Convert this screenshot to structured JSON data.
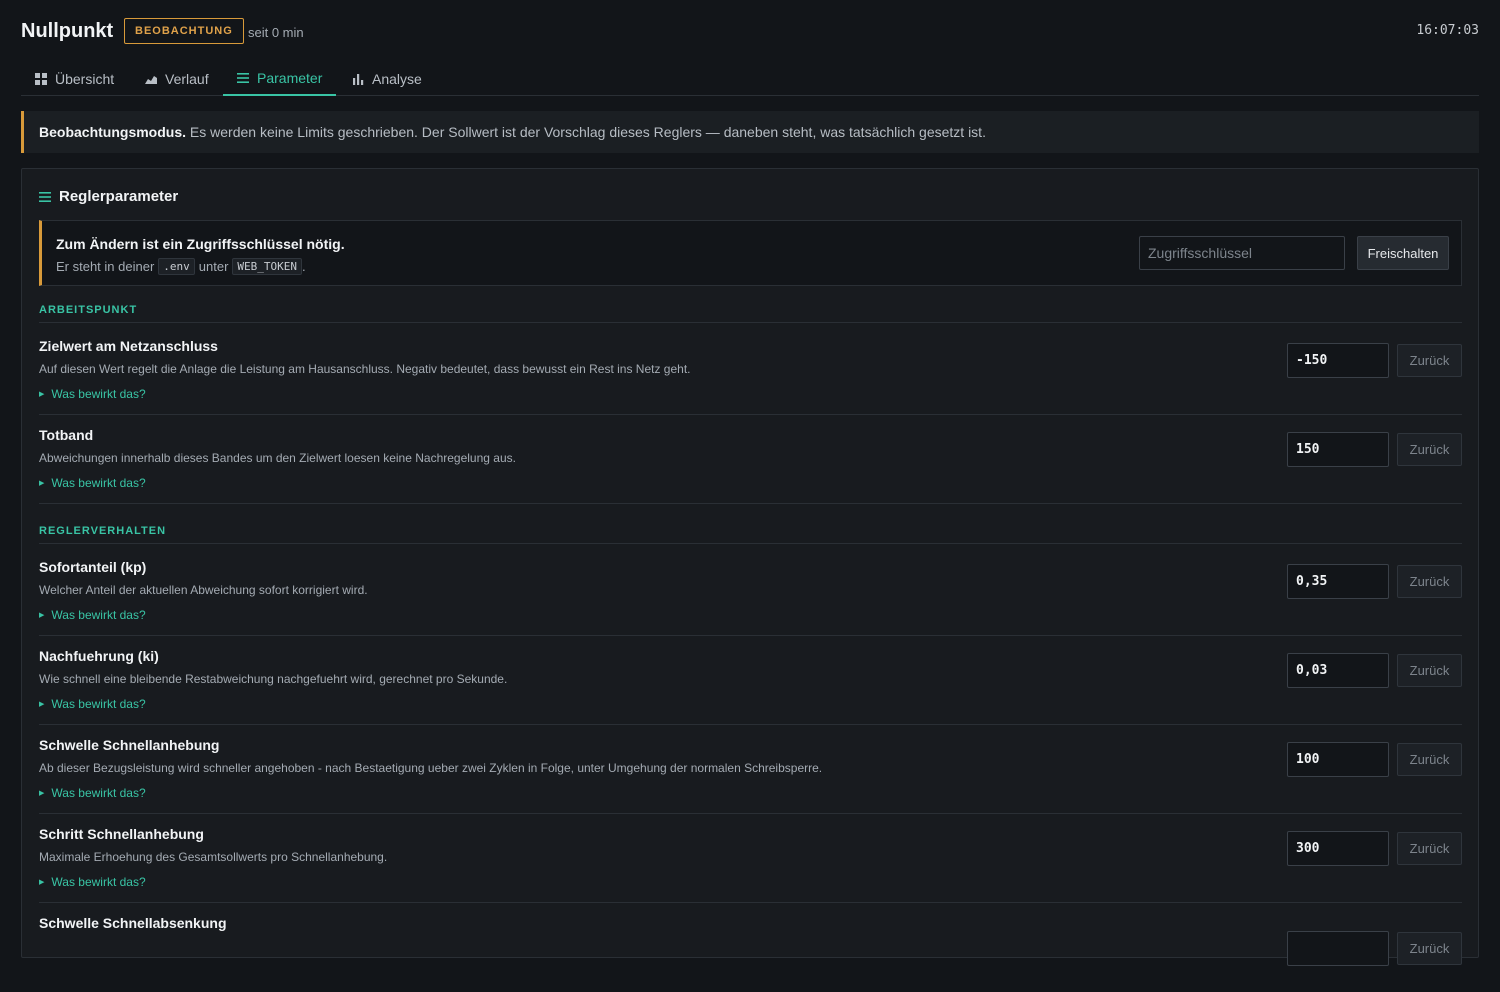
{
  "header": {
    "title": "Nullpunkt",
    "badge": "BEOBACHTUNG",
    "since": "seit 0 min",
    "clock": "16:07:03"
  },
  "tabs": [
    {
      "label": "Übersicht",
      "icon": "grid-icon"
    },
    {
      "label": "Verlauf",
      "icon": "area-chart-icon"
    },
    {
      "label": "Parameter",
      "icon": "list-icon",
      "active": true
    },
    {
      "label": "Analyse",
      "icon": "bar-chart-icon"
    }
  ],
  "banner": {
    "strong": "Beobachtungsmodus.",
    "text": " Es werden keine Limits geschrieben. Der Sollwert ist der Vorschlag dieses Reglers — daneben steht, was tatsächlich gesetzt ist."
  },
  "panel": {
    "title": "Reglerparameter",
    "key_box": {
      "title": "Zum Ändern ist ein Zugriffsschlüssel nötig.",
      "sub_prefix": "Er steht in deiner",
      "code1": ".env",
      "sub_mid": "unter",
      "code2": "WEB_TOKEN",
      "sub_suffix": ".",
      "placeholder": "Zugriffsschlüssel",
      "button": "Freischalten"
    },
    "sections": {
      "arbeitspunkt": "ARBEITSPUNKT",
      "reglerverhalten": "REGLERVERHALTEN"
    },
    "more_label": "Was bewirkt das?",
    "reset_label": "Zurück",
    "params": [
      {
        "title": "Zielwert am Netzanschluss",
        "desc": "Auf diesen Wert regelt die Anlage die Leistung am Hausanschluss. Negativ bedeutet, dass bewusst ein Rest ins Netz geht.",
        "value": "-150"
      },
      {
        "title": "Totband",
        "desc": "Abweichungen innerhalb dieses Bandes um den Zielwert loesen keine Nachregelung aus.",
        "value": "150"
      },
      {
        "title": "Sofortanteil (kp)",
        "desc": "Welcher Anteil der aktuellen Abweichung sofort korrigiert wird.",
        "value": "0,35"
      },
      {
        "title": "Nachfuehrung (ki)",
        "desc": "Wie schnell eine bleibende Restabweichung nachgefuehrt wird, gerechnet pro Sekunde.",
        "value": "0,03"
      },
      {
        "title": "Schwelle Schnellanhebung",
        "desc": "Ab dieser Bezugsleistung wird schneller angehoben - nach Bestaetigung ueber zwei Zyklen in Folge, unter Umgehung der normalen Schreibsperre.",
        "value": "100"
      },
      {
        "title": "Schritt Schnellanhebung",
        "desc": "Maximale Erhoehung des Gesamtsollwerts pro Schnellanhebung.",
        "value": "300"
      },
      {
        "title": "Schwelle Schnellabsenkung",
        "desc": "",
        "value": ""
      }
    ]
  }
}
